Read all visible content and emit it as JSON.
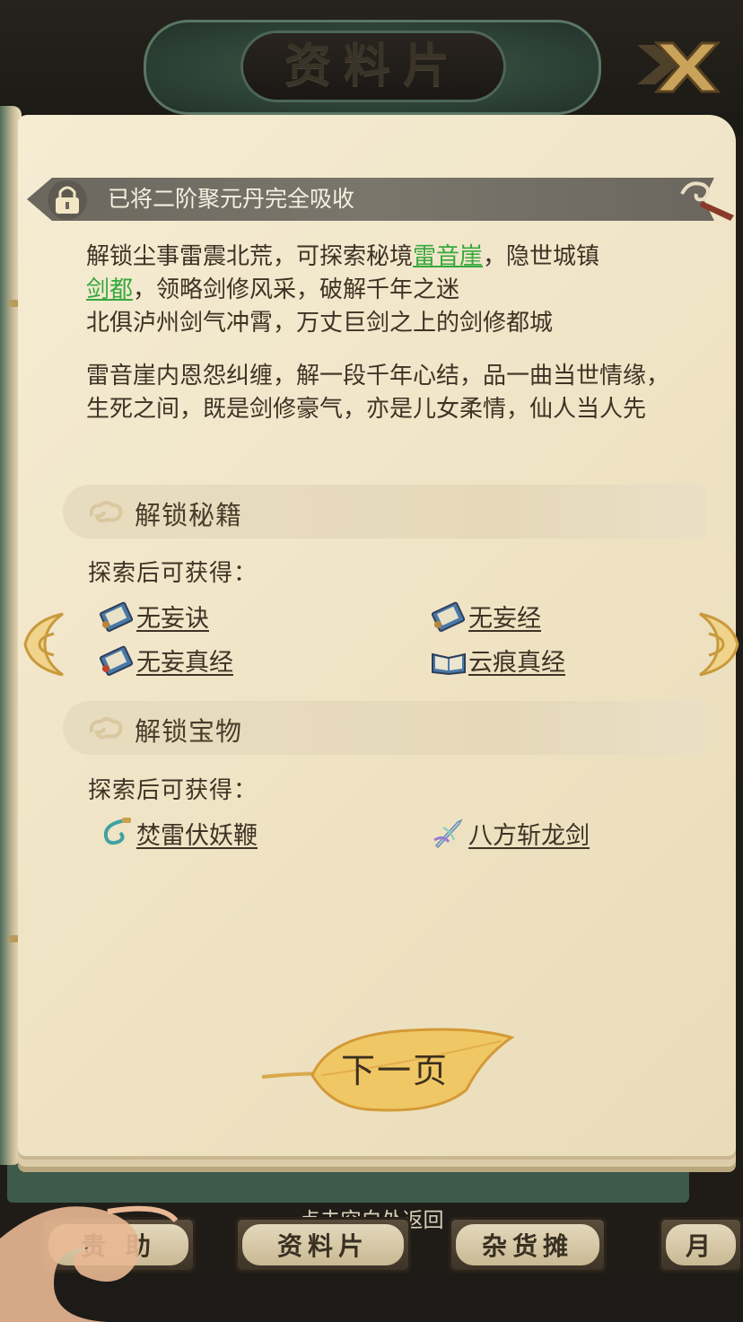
{
  "header": {
    "title": "资料片"
  },
  "status": {
    "text": "已将二阶聚元丹完全吸收"
  },
  "description": {
    "p1_before_link1": "解锁尘事雷震北荒，可探索秘境",
    "link1": "雷音崖",
    "p1_after_link1": "，隐世城镇",
    "link2": "剑都",
    "p1_after_link2": "，领略剑修风采，破解千年之迷",
    "p1_line3": "北俱泸州剑气冲霄，万丈巨剑之上的剑修都城",
    "p2": "雷音崖内恩怨纠缠，解一段千年心结，品一曲当世情缘，生死之间，既是剑修豪气，亦是儿女柔情，仙人当人先"
  },
  "sections": [
    {
      "title": "解锁秘籍",
      "subtitle": "探索后可获得：",
      "items": [
        {
          "label": "无妄诀",
          "icon": "scroll-book-icon"
        },
        {
          "label": "无妄经",
          "icon": "scroll-book-icon"
        },
        {
          "label": "无妄真经",
          "icon": "scroll-book-icon"
        },
        {
          "label": "云痕真经",
          "icon": "open-book-icon"
        }
      ]
    },
    {
      "title": "解锁宝物",
      "subtitle": "探索后可获得：",
      "items": [
        {
          "label": "焚雷伏妖鞭",
          "icon": "whip-icon"
        },
        {
          "label": "八方斩龙剑",
          "icon": "sword-icon"
        }
      ]
    }
  ],
  "next_button": {
    "label": "下一页"
  },
  "bottom": {
    "hint": "点击空白处返回",
    "tabs": [
      "贵 助",
      "资料片",
      "杂货摊",
      "月"
    ]
  },
  "colors": {
    "link": "#36a83e",
    "text": "#3e3325",
    "paper": "#f2e8cc",
    "status_bar": "#736f65"
  }
}
